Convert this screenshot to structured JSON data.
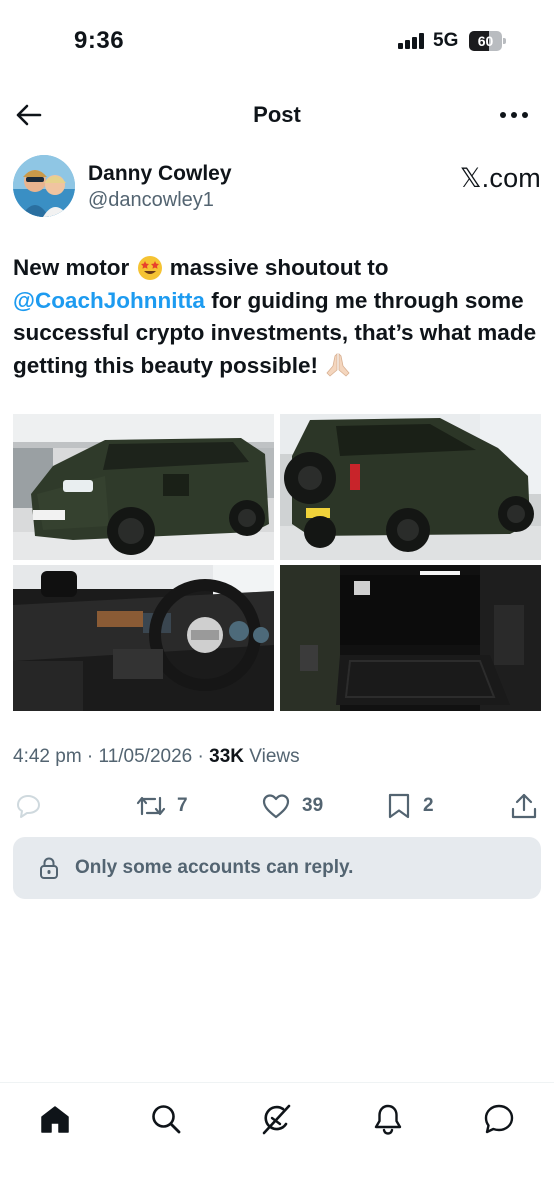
{
  "status_bar": {
    "time": "9:36",
    "network": "5G",
    "battery": "60",
    "battery_level": 0.6
  },
  "header": {
    "title": "Post",
    "back_icon": "arrow-left-icon",
    "more_icon": "more-horizontal-icon"
  },
  "author": {
    "name": "Danny Cowley",
    "handle": "@dancowley1",
    "source": "𝕏.com"
  },
  "tweet": {
    "text_before": "New motor ",
    "emoji_1": "star-struck-emoji",
    "text_middle": " massive shoutout to ",
    "mention": "@CoachJohnnitta",
    "text_after": " for guiding me through some successful crypto investments, that’s what made getting this beauty possible! ",
    "emoji_2": "folded-hands-emoji"
  },
  "media": [
    {
      "alt": "front-exterior-photo"
    },
    {
      "alt": "rear-exterior-photo"
    },
    {
      "alt": "interior-dashboard-photo"
    },
    {
      "alt": "cargo-area-photo"
    }
  ],
  "meta": {
    "time": "4:42 pm",
    "separator": " · ",
    "date": "11/05/2026",
    "separator2": " · ",
    "views_count": "33K",
    "views_label": " Views"
  },
  "actions": {
    "reply": {
      "icon": "reply-icon",
      "count": ""
    },
    "repost": {
      "icon": "repost-icon",
      "count": "7"
    },
    "like": {
      "icon": "heart-icon",
      "count": "39"
    },
    "bookmark": {
      "icon": "bookmark-icon",
      "count": "2"
    },
    "share": {
      "icon": "share-icon",
      "count": ""
    }
  },
  "reply_restriction": {
    "text": "Only some accounts can reply.",
    "icon": "lock-icon"
  },
  "tabbar": [
    {
      "name": "home",
      "icon": "home-icon",
      "active": true
    },
    {
      "name": "search",
      "icon": "search-icon",
      "active": false
    },
    {
      "name": "grok",
      "icon": "grok-icon",
      "active": false
    },
    {
      "name": "notifications",
      "icon": "bell-icon",
      "active": false
    },
    {
      "name": "messages",
      "icon": "message-icon",
      "active": false
    }
  ],
  "colors": {
    "text": "#0f1419",
    "secondary": "#536471",
    "link": "#1d9bf0",
    "banner_bg": "#e6eaee"
  }
}
